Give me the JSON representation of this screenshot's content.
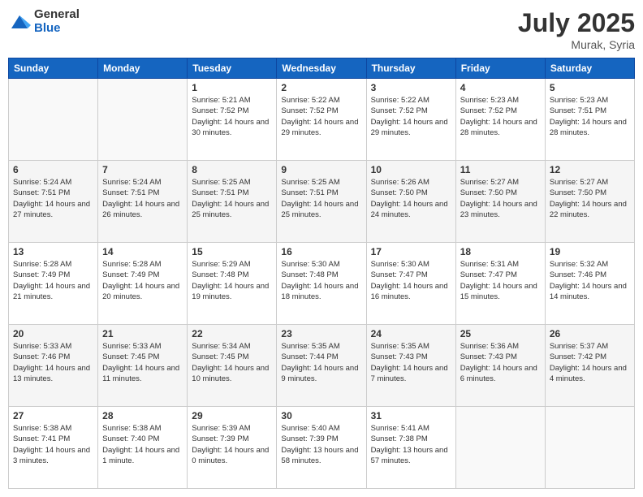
{
  "logo": {
    "general": "General",
    "blue": "Blue"
  },
  "title": "July 2025",
  "location": "Murak, Syria",
  "days_header": [
    "Sunday",
    "Monday",
    "Tuesday",
    "Wednesday",
    "Thursday",
    "Friday",
    "Saturday"
  ],
  "weeks": [
    [
      {
        "day": "",
        "info": ""
      },
      {
        "day": "",
        "info": ""
      },
      {
        "day": "1",
        "info": "Sunrise: 5:21 AM\nSunset: 7:52 PM\nDaylight: 14 hours and 30 minutes."
      },
      {
        "day": "2",
        "info": "Sunrise: 5:22 AM\nSunset: 7:52 PM\nDaylight: 14 hours and 29 minutes."
      },
      {
        "day": "3",
        "info": "Sunrise: 5:22 AM\nSunset: 7:52 PM\nDaylight: 14 hours and 29 minutes."
      },
      {
        "day": "4",
        "info": "Sunrise: 5:23 AM\nSunset: 7:52 PM\nDaylight: 14 hours and 28 minutes."
      },
      {
        "day": "5",
        "info": "Sunrise: 5:23 AM\nSunset: 7:51 PM\nDaylight: 14 hours and 28 minutes."
      }
    ],
    [
      {
        "day": "6",
        "info": "Sunrise: 5:24 AM\nSunset: 7:51 PM\nDaylight: 14 hours and 27 minutes."
      },
      {
        "day": "7",
        "info": "Sunrise: 5:24 AM\nSunset: 7:51 PM\nDaylight: 14 hours and 26 minutes."
      },
      {
        "day": "8",
        "info": "Sunrise: 5:25 AM\nSunset: 7:51 PM\nDaylight: 14 hours and 25 minutes."
      },
      {
        "day": "9",
        "info": "Sunrise: 5:25 AM\nSunset: 7:51 PM\nDaylight: 14 hours and 25 minutes."
      },
      {
        "day": "10",
        "info": "Sunrise: 5:26 AM\nSunset: 7:50 PM\nDaylight: 14 hours and 24 minutes."
      },
      {
        "day": "11",
        "info": "Sunrise: 5:27 AM\nSunset: 7:50 PM\nDaylight: 14 hours and 23 minutes."
      },
      {
        "day": "12",
        "info": "Sunrise: 5:27 AM\nSunset: 7:50 PM\nDaylight: 14 hours and 22 minutes."
      }
    ],
    [
      {
        "day": "13",
        "info": "Sunrise: 5:28 AM\nSunset: 7:49 PM\nDaylight: 14 hours and 21 minutes."
      },
      {
        "day": "14",
        "info": "Sunrise: 5:28 AM\nSunset: 7:49 PM\nDaylight: 14 hours and 20 minutes."
      },
      {
        "day": "15",
        "info": "Sunrise: 5:29 AM\nSunset: 7:48 PM\nDaylight: 14 hours and 19 minutes."
      },
      {
        "day": "16",
        "info": "Sunrise: 5:30 AM\nSunset: 7:48 PM\nDaylight: 14 hours and 18 minutes."
      },
      {
        "day": "17",
        "info": "Sunrise: 5:30 AM\nSunset: 7:47 PM\nDaylight: 14 hours and 16 minutes."
      },
      {
        "day": "18",
        "info": "Sunrise: 5:31 AM\nSunset: 7:47 PM\nDaylight: 14 hours and 15 minutes."
      },
      {
        "day": "19",
        "info": "Sunrise: 5:32 AM\nSunset: 7:46 PM\nDaylight: 14 hours and 14 minutes."
      }
    ],
    [
      {
        "day": "20",
        "info": "Sunrise: 5:33 AM\nSunset: 7:46 PM\nDaylight: 14 hours and 13 minutes."
      },
      {
        "day": "21",
        "info": "Sunrise: 5:33 AM\nSunset: 7:45 PM\nDaylight: 14 hours and 11 minutes."
      },
      {
        "day": "22",
        "info": "Sunrise: 5:34 AM\nSunset: 7:45 PM\nDaylight: 14 hours and 10 minutes."
      },
      {
        "day": "23",
        "info": "Sunrise: 5:35 AM\nSunset: 7:44 PM\nDaylight: 14 hours and 9 minutes."
      },
      {
        "day": "24",
        "info": "Sunrise: 5:35 AM\nSunset: 7:43 PM\nDaylight: 14 hours and 7 minutes."
      },
      {
        "day": "25",
        "info": "Sunrise: 5:36 AM\nSunset: 7:43 PM\nDaylight: 14 hours and 6 minutes."
      },
      {
        "day": "26",
        "info": "Sunrise: 5:37 AM\nSunset: 7:42 PM\nDaylight: 14 hours and 4 minutes."
      }
    ],
    [
      {
        "day": "27",
        "info": "Sunrise: 5:38 AM\nSunset: 7:41 PM\nDaylight: 14 hours and 3 minutes."
      },
      {
        "day": "28",
        "info": "Sunrise: 5:38 AM\nSunset: 7:40 PM\nDaylight: 14 hours and 1 minute."
      },
      {
        "day": "29",
        "info": "Sunrise: 5:39 AM\nSunset: 7:39 PM\nDaylight: 14 hours and 0 minutes."
      },
      {
        "day": "30",
        "info": "Sunrise: 5:40 AM\nSunset: 7:39 PM\nDaylight: 13 hours and 58 minutes."
      },
      {
        "day": "31",
        "info": "Sunrise: 5:41 AM\nSunset: 7:38 PM\nDaylight: 13 hours and 57 minutes."
      },
      {
        "day": "",
        "info": ""
      },
      {
        "day": "",
        "info": ""
      }
    ]
  ]
}
